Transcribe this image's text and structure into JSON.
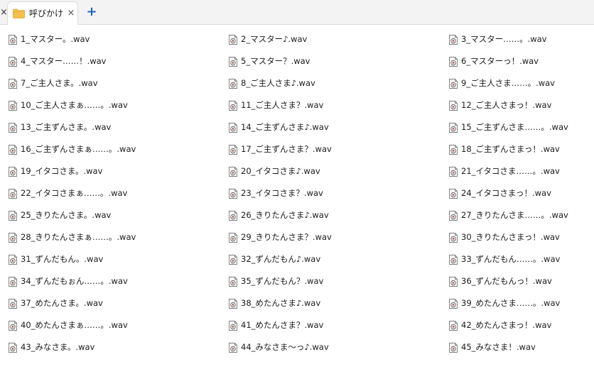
{
  "tabbar": {
    "active_tab_title": "呼びかけ",
    "close_glyph": "×",
    "new_tab_glyph": "+",
    "colors": {
      "folder": "#f2c14e",
      "new_tab": "#1f5fbf"
    }
  },
  "file_icon": "wav-audio-file-icon",
  "files": [
    "1_マスター。.wav",
    "2_マスター♪.wav",
    "3_マスター……。.wav",
    "4_マスター……！.wav",
    "5_マスター？.wav",
    "6_マスターっ！.wav",
    "7_ご主人さま。.wav",
    "8_ご主人さま♪.wav",
    "9_ご主人さま……。.wav",
    "10_ご主人さまぁ……。.wav",
    "11_ご主人さま？.wav",
    "12_ご主人さまっ！.wav",
    "13_ご主ずんさま。.wav",
    "14_ご主ずんさま♪.wav",
    "15_ご主ずんさま……。.wav",
    "16_ご主ずんさまぁ……。.wav",
    "17_ご主ずんさま？.wav",
    "18_ご主ずんさまっ！.wav",
    "19_イタコさま。.wav",
    "20_イタコさま♪.wav",
    "21_イタコさま……。.wav",
    "22_イタコさまぁ……。.wav",
    "23_イタコさま？.wav",
    "24_イタコさまっ！.wav",
    "25_きりたんさま。.wav",
    "26_きりたんさま♪.wav",
    "27_きりたんさま……。.wav",
    "28_きりたんさまぁ……。.wav",
    "29_きりたんさま？.wav",
    "30_きりたんさまっ！.wav",
    "31_ずんだもん。.wav",
    "32_ずんだもん♪.wav",
    "33_ずんだもん……。.wav",
    "34_ずんだもぉん……。.wav",
    "35_ずんだもん？.wav",
    "36_ずんだもんっ！.wav",
    "37_めたんさま。.wav",
    "38_めたんさま♪.wav",
    "39_めたんさま……。.wav",
    "40_めたんさまぁ……。.wav",
    "41_めたんさま？.wav",
    "42_めたんさまっ！.wav",
    "43_みなさま。.wav",
    "44_みなさま〜っ♪.wav",
    "45_みなさま！.wav"
  ]
}
